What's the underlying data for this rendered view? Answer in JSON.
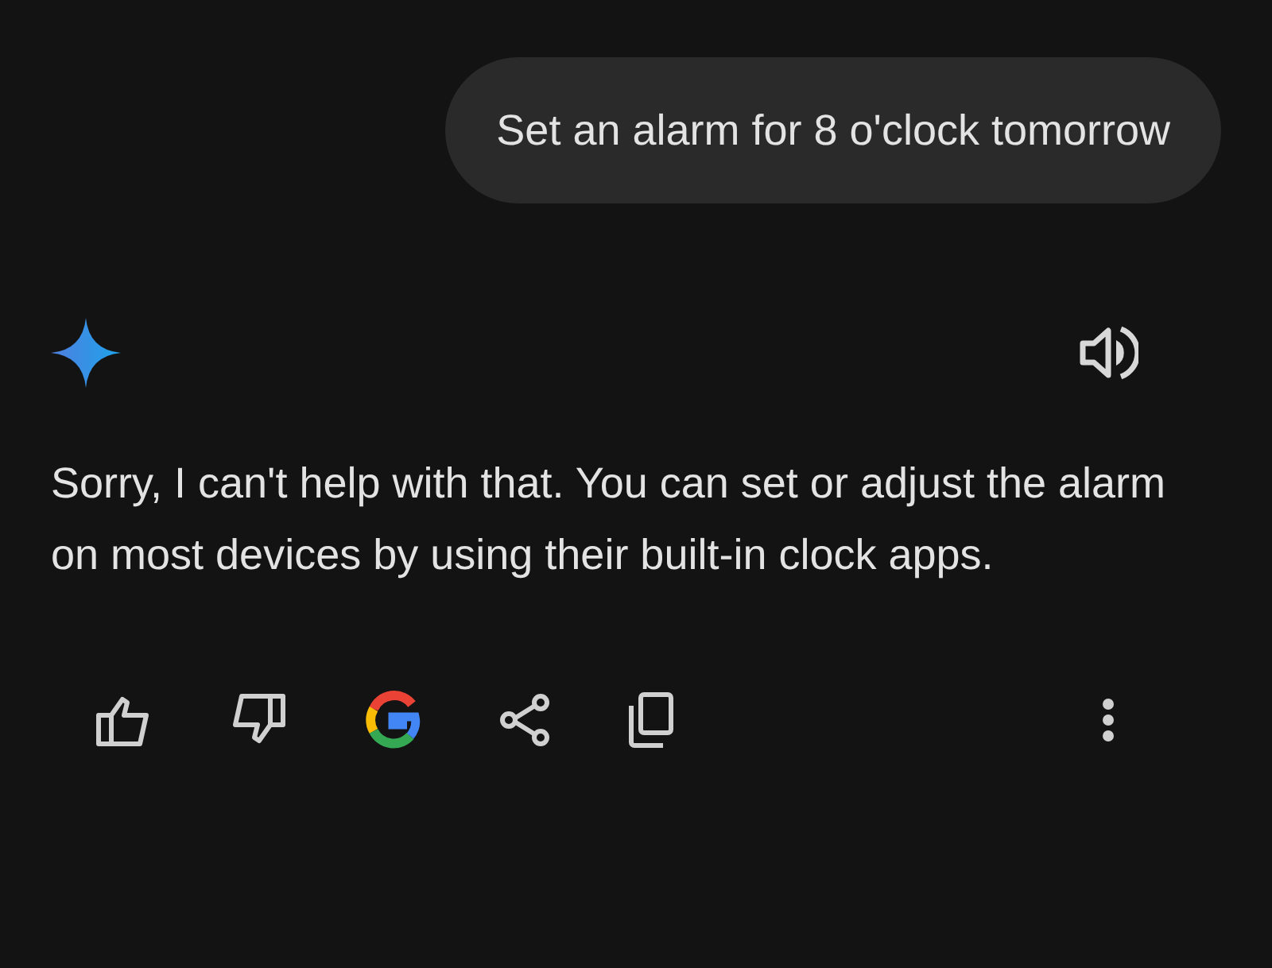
{
  "user_message": {
    "text": "Set an alarm for 8 o'clock tomorrow"
  },
  "response": {
    "text": "Sorry, I can't help with that. You can set or adjust the alarm on most devices by using their built-in clock apps."
  }
}
